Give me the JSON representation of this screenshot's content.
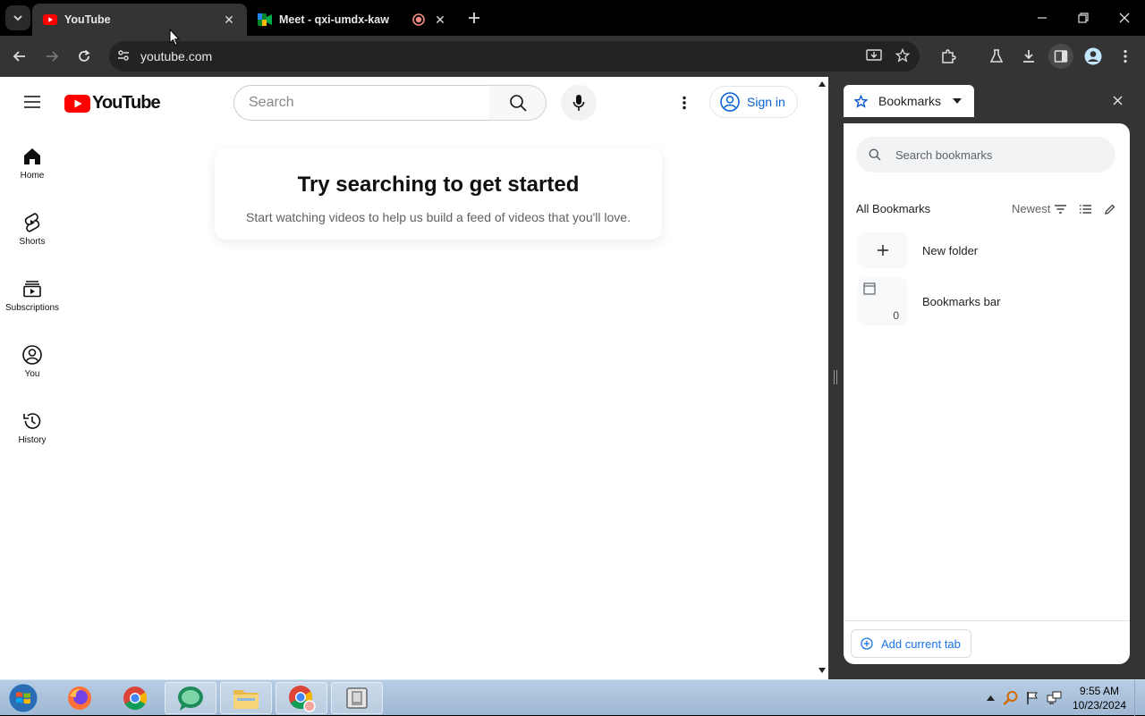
{
  "browser": {
    "tabs": [
      {
        "title": "YouTube",
        "active": true
      },
      {
        "title": "Meet - qxi-umdx-kaw",
        "active": false
      }
    ],
    "url": "youtube.com"
  },
  "youtube": {
    "logo_text": "YouTube",
    "search_placeholder": "Search",
    "sign_in_label": "Sign in",
    "nav": [
      {
        "label": "Home",
        "icon": "home-icon"
      },
      {
        "label": "Shorts",
        "icon": "shorts-icon"
      },
      {
        "label": "Subscriptions",
        "icon": "subscriptions-icon"
      },
      {
        "label": "You",
        "icon": "you-icon"
      },
      {
        "label": "History",
        "icon": "history-icon"
      }
    ],
    "empty_title": "Try searching to get started",
    "empty_subtitle": "Start watching videos to help us build a feed of videos that you'll love."
  },
  "side_panel": {
    "title": "Bookmarks",
    "search_placeholder": "Search bookmarks",
    "all_label": "All Bookmarks",
    "sort_label": "Newest",
    "new_folder_label": "New folder",
    "items": [
      {
        "label": "Bookmarks bar",
        "count": "0"
      }
    ],
    "add_tab_label": "Add current tab"
  },
  "taskbar": {
    "time": "9:55 AM",
    "date": "10/23/2024"
  },
  "colors": {
    "youtube_red": "#ff0000",
    "link_blue": "#065fd4",
    "chrome_dark": "#343434"
  }
}
